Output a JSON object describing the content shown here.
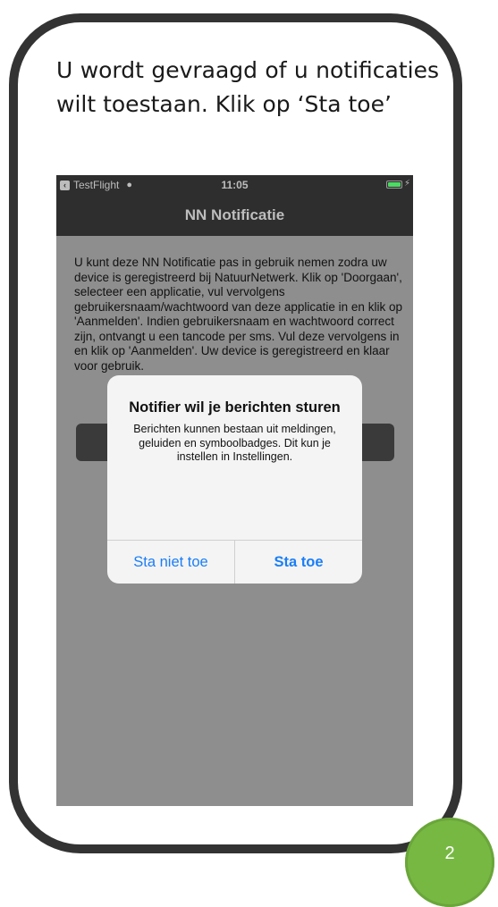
{
  "instruction": "U wordt gevraagd of u notificaties wilt toestaan. Klik op ‘Sta toe’",
  "status_bar": {
    "carrier": "TestFlight",
    "time": "11:05",
    "icons": [
      "back-arrow-icon",
      "wifi-icon",
      "battery-icon",
      "charging-icon"
    ],
    "battery_color": "#4cd964"
  },
  "navbar": {
    "title": "NN Notificatie"
  },
  "body": {
    "text": "U kunt deze NN Notificatie pas in gebruik nemen zodra uw device is geregistreerd bij NatuurNetwerk. Klik op 'Doorgaan', selecteer een applicatie, vul vervolgens gebruikersnaam/wachtwoord van deze applicatie in en klik op 'Aanmelden'. Indien gebruikersnaam en wachtwoord correct zijn, ontvangt u een tancode per sms. Vul deze vervolgens in en klik op 'Aanmelden'. Uw device is geregistreerd en klaar voor gebruik."
  },
  "alert": {
    "title": "Notifier wil je berichten sturen",
    "message": "Berichten kunnen bestaan uit meldingen, geluiden en symboolbadges. Dit kun je instellen in Instellingen.",
    "deny_label": "Sta niet toe",
    "allow_label": "Sta toe",
    "button_color": "#1a7ef7"
  },
  "page_number": "2",
  "colors": {
    "frame": "#333333",
    "badge": "#77b843",
    "screen_overlay": "#8e8e8e",
    "bar": "#2e2e2e"
  }
}
